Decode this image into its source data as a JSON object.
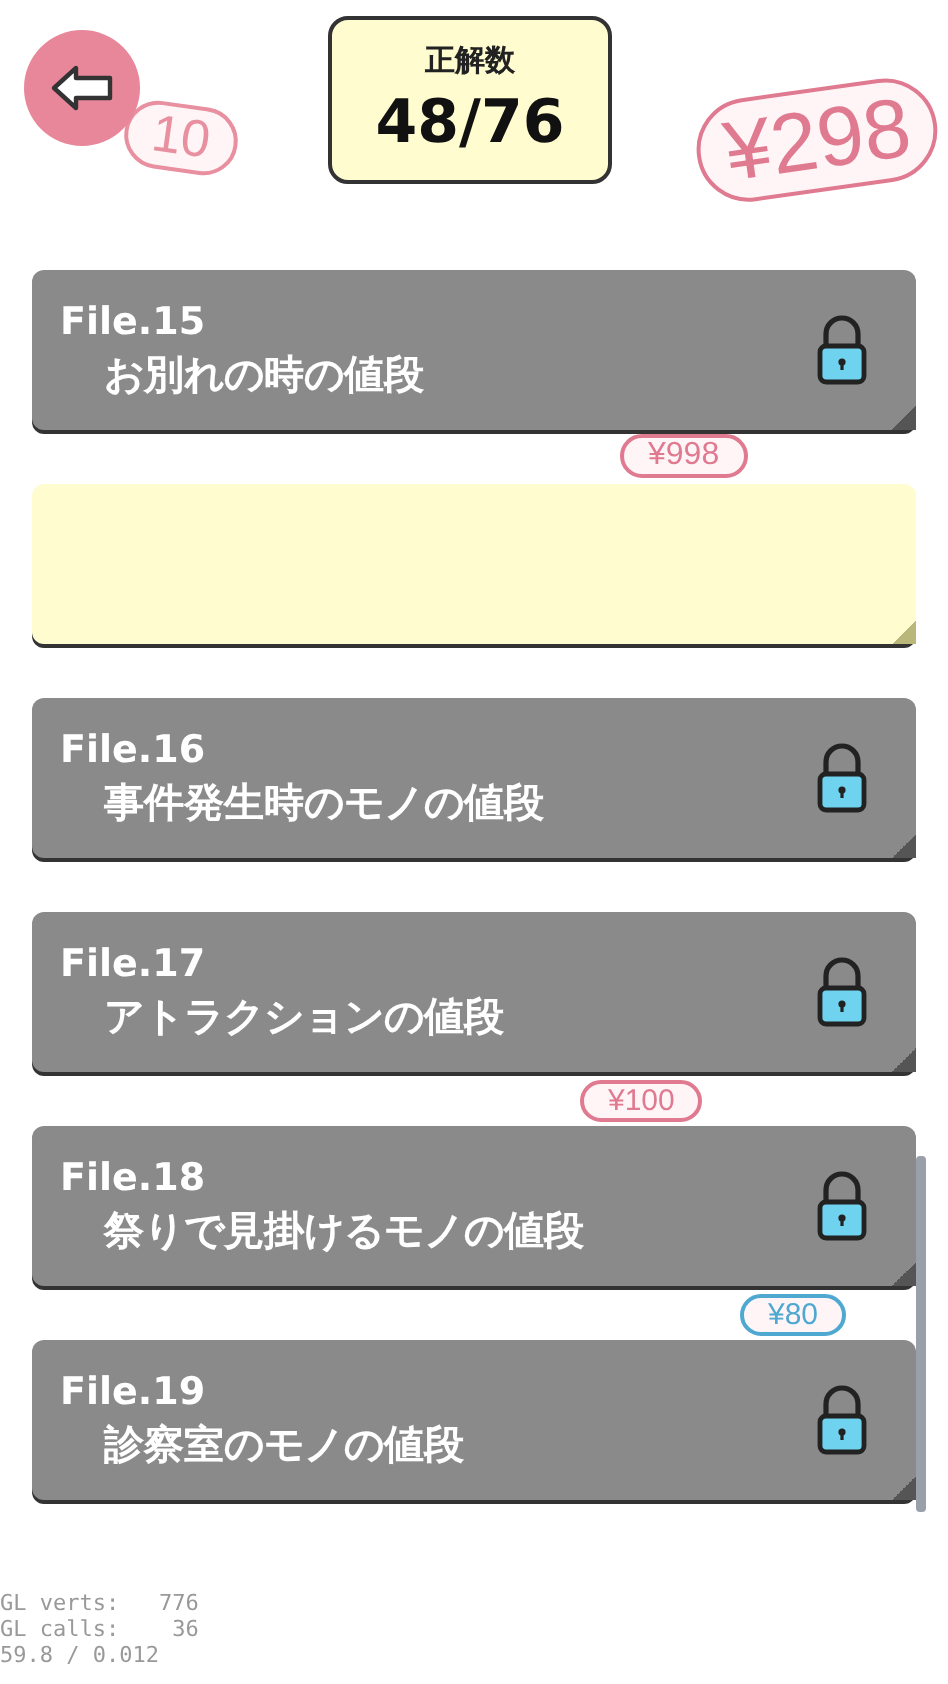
{
  "header": {
    "score_label": "正解数",
    "score": "48/76"
  },
  "background_tags": [
    {
      "text": "10",
      "color": "#e88fa0"
    },
    {
      "text": "¥298",
      "color": "#e07a90"
    },
    {
      "text": "¥998",
      "color": "#e07a90"
    },
    {
      "text": "¥100",
      "color": "#e07a90"
    },
    {
      "text": "¥80",
      "color": "#4fa8d0"
    }
  ],
  "files": [
    {
      "kind": "file",
      "file": "File.15",
      "title": "お別れの時の値段",
      "locked": true
    },
    {
      "kind": "blank"
    },
    {
      "kind": "file",
      "file": "File.16",
      "title": "事件発生時のモノの値段",
      "locked": true
    },
    {
      "kind": "file",
      "file": "File.17",
      "title": "アトラクションの値段",
      "locked": true
    },
    {
      "kind": "file",
      "file": "File.18",
      "title": "祭りで見掛けるモノの値段",
      "locked": true
    },
    {
      "kind": "file",
      "file": "File.19",
      "title": "診察室のモノの値段",
      "locked": true
    }
  ],
  "debug": [
    "GL verts:   776",
    "GL calls:    36",
    "59.8 / 0.012"
  ]
}
